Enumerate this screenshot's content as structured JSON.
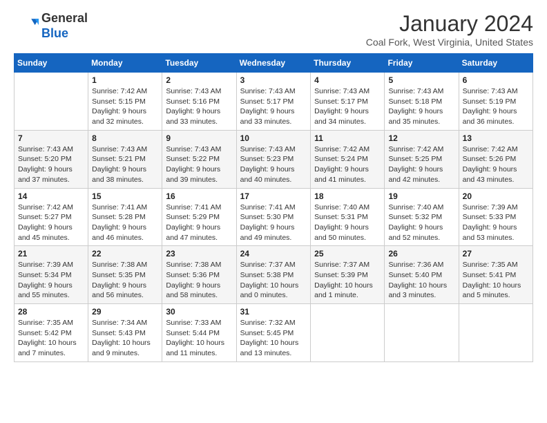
{
  "logo": {
    "line1": "General",
    "line2": "Blue"
  },
  "title": "January 2024",
  "subtitle": "Coal Fork, West Virginia, United States",
  "days_header": [
    "Sunday",
    "Monday",
    "Tuesday",
    "Wednesday",
    "Thursday",
    "Friday",
    "Saturday"
  ],
  "weeks": [
    [
      {
        "day": "",
        "info": ""
      },
      {
        "day": "1",
        "info": "Sunrise: 7:42 AM\nSunset: 5:15 PM\nDaylight: 9 hours\nand 32 minutes."
      },
      {
        "day": "2",
        "info": "Sunrise: 7:43 AM\nSunset: 5:16 PM\nDaylight: 9 hours\nand 33 minutes."
      },
      {
        "day": "3",
        "info": "Sunrise: 7:43 AM\nSunset: 5:17 PM\nDaylight: 9 hours\nand 33 minutes."
      },
      {
        "day": "4",
        "info": "Sunrise: 7:43 AM\nSunset: 5:17 PM\nDaylight: 9 hours\nand 34 minutes."
      },
      {
        "day": "5",
        "info": "Sunrise: 7:43 AM\nSunset: 5:18 PM\nDaylight: 9 hours\nand 35 minutes."
      },
      {
        "day": "6",
        "info": "Sunrise: 7:43 AM\nSunset: 5:19 PM\nDaylight: 9 hours\nand 36 minutes."
      }
    ],
    [
      {
        "day": "7",
        "info": "Sunrise: 7:43 AM\nSunset: 5:20 PM\nDaylight: 9 hours\nand 37 minutes."
      },
      {
        "day": "8",
        "info": "Sunrise: 7:43 AM\nSunset: 5:21 PM\nDaylight: 9 hours\nand 38 minutes."
      },
      {
        "day": "9",
        "info": "Sunrise: 7:43 AM\nSunset: 5:22 PM\nDaylight: 9 hours\nand 39 minutes."
      },
      {
        "day": "10",
        "info": "Sunrise: 7:43 AM\nSunset: 5:23 PM\nDaylight: 9 hours\nand 40 minutes."
      },
      {
        "day": "11",
        "info": "Sunrise: 7:42 AM\nSunset: 5:24 PM\nDaylight: 9 hours\nand 41 minutes."
      },
      {
        "day": "12",
        "info": "Sunrise: 7:42 AM\nSunset: 5:25 PM\nDaylight: 9 hours\nand 42 minutes."
      },
      {
        "day": "13",
        "info": "Sunrise: 7:42 AM\nSunset: 5:26 PM\nDaylight: 9 hours\nand 43 minutes."
      }
    ],
    [
      {
        "day": "14",
        "info": "Sunrise: 7:42 AM\nSunset: 5:27 PM\nDaylight: 9 hours\nand 45 minutes."
      },
      {
        "day": "15",
        "info": "Sunrise: 7:41 AM\nSunset: 5:28 PM\nDaylight: 9 hours\nand 46 minutes."
      },
      {
        "day": "16",
        "info": "Sunrise: 7:41 AM\nSunset: 5:29 PM\nDaylight: 9 hours\nand 47 minutes."
      },
      {
        "day": "17",
        "info": "Sunrise: 7:41 AM\nSunset: 5:30 PM\nDaylight: 9 hours\nand 49 minutes."
      },
      {
        "day": "18",
        "info": "Sunrise: 7:40 AM\nSunset: 5:31 PM\nDaylight: 9 hours\nand 50 minutes."
      },
      {
        "day": "19",
        "info": "Sunrise: 7:40 AM\nSunset: 5:32 PM\nDaylight: 9 hours\nand 52 minutes."
      },
      {
        "day": "20",
        "info": "Sunrise: 7:39 AM\nSunset: 5:33 PM\nDaylight: 9 hours\nand 53 minutes."
      }
    ],
    [
      {
        "day": "21",
        "info": "Sunrise: 7:39 AM\nSunset: 5:34 PM\nDaylight: 9 hours\nand 55 minutes."
      },
      {
        "day": "22",
        "info": "Sunrise: 7:38 AM\nSunset: 5:35 PM\nDaylight: 9 hours\nand 56 minutes."
      },
      {
        "day": "23",
        "info": "Sunrise: 7:38 AM\nSunset: 5:36 PM\nDaylight: 9 hours\nand 58 minutes."
      },
      {
        "day": "24",
        "info": "Sunrise: 7:37 AM\nSunset: 5:38 PM\nDaylight: 10 hours\nand 0 minutes."
      },
      {
        "day": "25",
        "info": "Sunrise: 7:37 AM\nSunset: 5:39 PM\nDaylight: 10 hours\nand 1 minute."
      },
      {
        "day": "26",
        "info": "Sunrise: 7:36 AM\nSunset: 5:40 PM\nDaylight: 10 hours\nand 3 minutes."
      },
      {
        "day": "27",
        "info": "Sunrise: 7:35 AM\nSunset: 5:41 PM\nDaylight: 10 hours\nand 5 minutes."
      }
    ],
    [
      {
        "day": "28",
        "info": "Sunrise: 7:35 AM\nSunset: 5:42 PM\nDaylight: 10 hours\nand 7 minutes."
      },
      {
        "day": "29",
        "info": "Sunrise: 7:34 AM\nSunset: 5:43 PM\nDaylight: 10 hours\nand 9 minutes."
      },
      {
        "day": "30",
        "info": "Sunrise: 7:33 AM\nSunset: 5:44 PM\nDaylight: 10 hours\nand 11 minutes."
      },
      {
        "day": "31",
        "info": "Sunrise: 7:32 AM\nSunset: 5:45 PM\nDaylight: 10 hours\nand 13 minutes."
      },
      {
        "day": "",
        "info": ""
      },
      {
        "day": "",
        "info": ""
      },
      {
        "day": "",
        "info": ""
      }
    ]
  ]
}
